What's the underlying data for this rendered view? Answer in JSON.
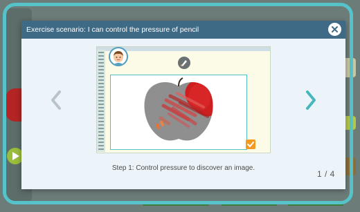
{
  "modal": {
    "title": "Exercise scenario: I can control the pressure of pencil",
    "step_text": "Step 1: Control pressure to discover an image.",
    "pager": "1 / 4"
  },
  "icons": {
    "close": "close-icon",
    "prev": "chevron-left-icon",
    "next": "chevron-right-icon",
    "avatar": "boy-avatar",
    "tool": "pencil-tool-icon",
    "check": "checkmark-icon"
  },
  "colors": {
    "frame": "#55c3c9",
    "header": "#3f6a86",
    "nav_arrows": "#45b7bd",
    "apple_red": "#cc1f1f",
    "checkbox": "#f39a23"
  }
}
